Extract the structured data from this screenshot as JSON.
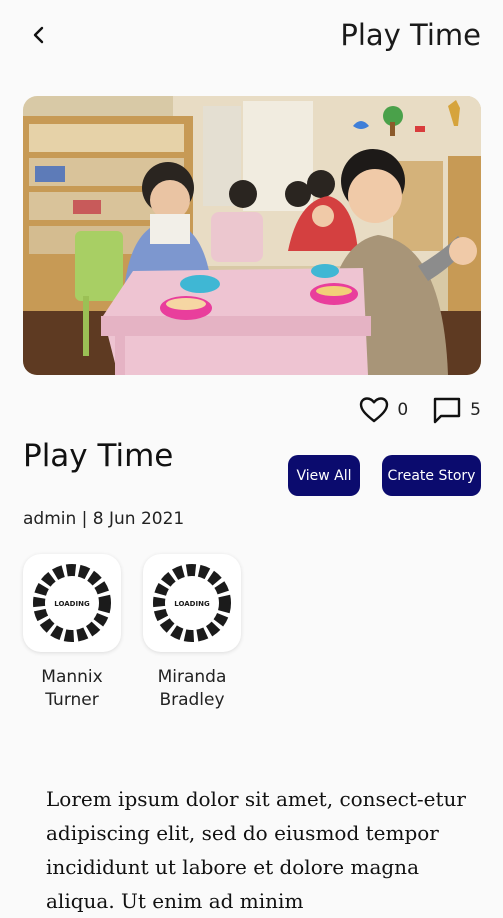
{
  "appbar": {
    "title": "Play Time"
  },
  "hero": {
    "alt": "children at play table"
  },
  "stats": {
    "likes": "0",
    "comments": "5"
  },
  "post": {
    "title": "Play Time",
    "meta": "admin | 8 Jun 2021",
    "body": "Lorem ipsum dolor sit amet, consect-etur adipiscing elit, sed do eiusmod tempor incididunt ut labore et dolore magna aliqua. Ut enim ad minim"
  },
  "buttons": {
    "view_all": "View All",
    "create_story": "Create Story"
  },
  "users": [
    {
      "name": "Mannix Turner",
      "loading_label": "LOADING"
    },
    {
      "name": "Miranda Bradley",
      "loading_label": "LOADING"
    }
  ],
  "colors": {
    "accent": "#0b0b6e",
    "background": "#fafafa"
  }
}
